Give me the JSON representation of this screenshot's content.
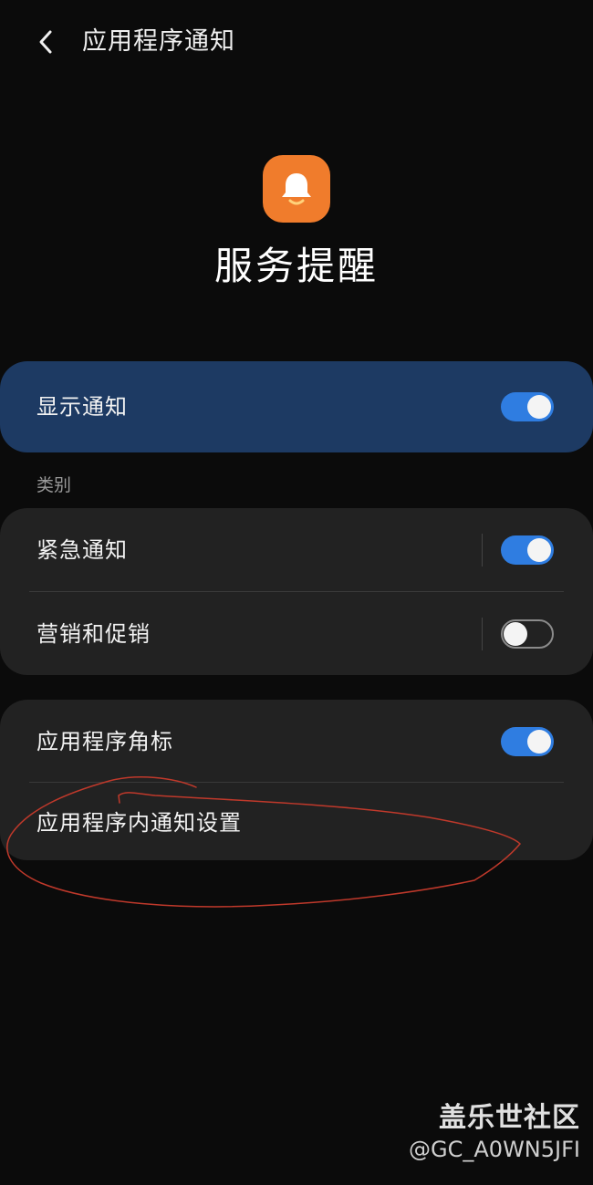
{
  "header": {
    "back_icon": "chevron-left-icon",
    "title": "应用程序通知"
  },
  "app": {
    "icon": "bell-icon",
    "icon_color": "#f07c2c",
    "name": "服务提醒"
  },
  "master": {
    "label": "显示通知",
    "enabled": true,
    "bg_color": "#1d3a63"
  },
  "categories": {
    "section_label": "类别",
    "items": [
      {
        "label": "紧急通知",
        "enabled": true
      },
      {
        "label": "营销和促销",
        "enabled": false
      }
    ]
  },
  "other": {
    "badge_label": "应用程序角标",
    "badge_enabled": true,
    "in_app_label": "应用程序内通知设置"
  },
  "accent_color": "#2f7de1",
  "annotation_color": "#c0392b",
  "watermark": {
    "title": "盖乐世社区",
    "user": "@GC_A0WN5JFI"
  }
}
